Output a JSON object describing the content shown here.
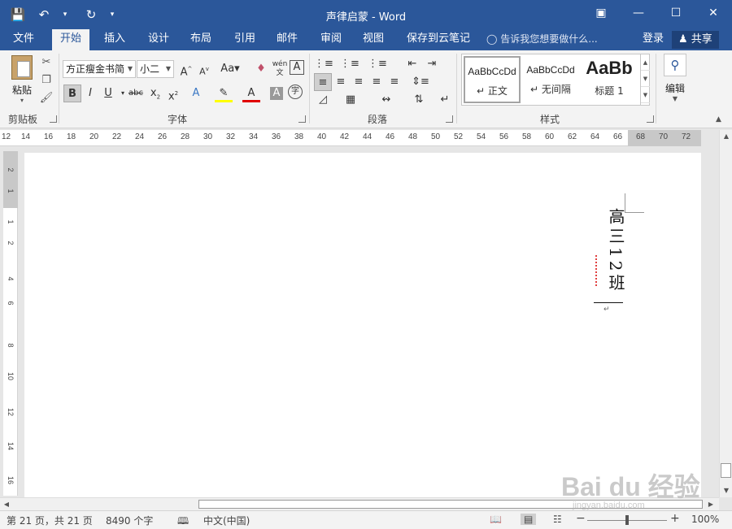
{
  "window": {
    "title": "声律启蒙 - Word",
    "controls": [
      "restore-ribbon",
      "minimize",
      "maximize",
      "close"
    ]
  },
  "qat": {
    "save_icon": "save-icon",
    "undo_icon": "undo-icon",
    "redo_icon": "redo-icon"
  },
  "tabs": [
    {
      "label": "文件"
    },
    {
      "label": "开始"
    },
    {
      "label": "插入"
    },
    {
      "label": "设计"
    },
    {
      "label": "布局"
    },
    {
      "label": "引用"
    },
    {
      "label": "邮件"
    },
    {
      "label": "审阅"
    },
    {
      "label": "视图"
    },
    {
      "label": "保存到云笔记"
    }
  ],
  "tellme": "告诉我您想要做什么...",
  "account": {
    "login": "登录",
    "share": "共享"
  },
  "ribbon": {
    "clipboard": {
      "paste": "粘贴",
      "label": "剪贴板"
    },
    "font": {
      "name": "方正瘦金书简",
      "size": "小二",
      "label": "字体",
      "change_case": "Aa",
      "phonetic": "wén"
    },
    "paragraph": {
      "label": "段落"
    },
    "styles": {
      "label": "样式",
      "items": [
        {
          "sample": "AaBbCcDd",
          "name": "正文"
        },
        {
          "sample": "AaBbCcDd",
          "name": "无间隔"
        },
        {
          "sample": "AaBb",
          "name": "标题 1"
        }
      ]
    },
    "editing": {
      "label": "编辑"
    }
  },
  "ruler": {
    "ticks": [
      "12",
      "14",
      "16",
      "18",
      "20",
      "22",
      "24",
      "26",
      "28",
      "30",
      "32",
      "34",
      "36",
      "38",
      "40",
      "42",
      "44",
      "46",
      "48",
      "50",
      "52",
      "54",
      "56",
      "58",
      "60",
      "62",
      "64",
      "66",
      "68",
      "70",
      "72"
    ]
  },
  "vruler": {
    "ticks": [
      "2",
      "1",
      "",
      "1",
      "2",
      "4",
      "6",
      "8",
      "10",
      "12",
      "14",
      "16",
      "18"
    ]
  },
  "document": {
    "vertical_text": "高三12班"
  },
  "status": {
    "page": "第 21 页，共 21 页",
    "words": "8490 个字",
    "language": "中文(中国)",
    "zoom": "100%"
  },
  "watermark": {
    "text": "Bai du 经验",
    "sub": "jingyan.baidu.com"
  }
}
